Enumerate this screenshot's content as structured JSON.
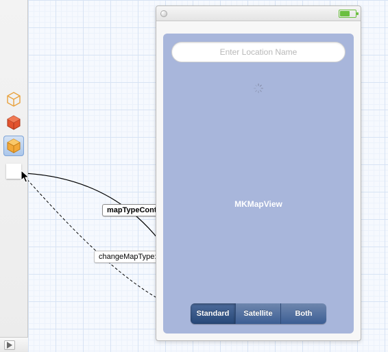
{
  "sidebar": {
    "items": [
      {
        "name": "object-outline",
        "selected": false
      },
      {
        "name": "object-red",
        "selected": false
      },
      {
        "name": "object-orange",
        "selected": true
      },
      {
        "name": "empty-placeholder",
        "selected": false
      }
    ]
  },
  "device": {
    "search_placeholder": "Enter Location Name",
    "map_label": "MKMapView",
    "segments": {
      "standard": "Standard",
      "satellite": "Satellite",
      "both": "Both"
    }
  },
  "connections": {
    "outlet_label": "mapTypeControl",
    "action_label": "changeMapType:"
  }
}
